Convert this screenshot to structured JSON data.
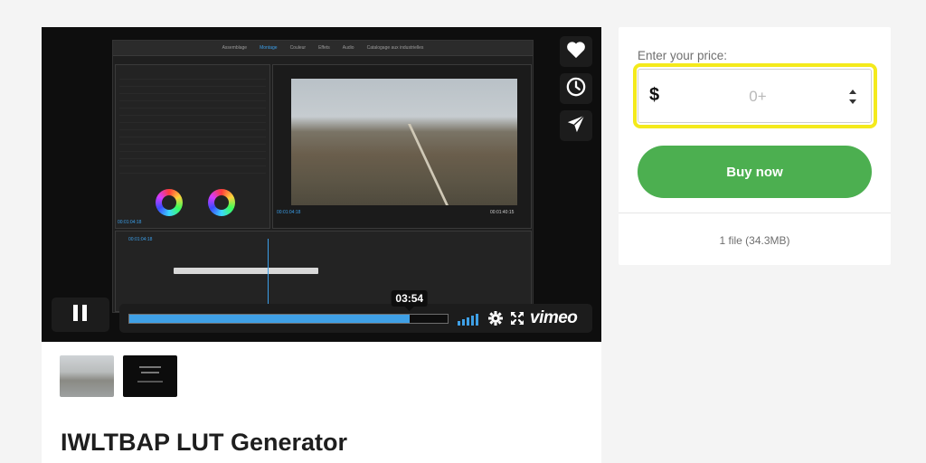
{
  "player": {
    "editor_tabs": [
      "Assemblage",
      "Montage",
      "Couleur",
      "Effets",
      "Audio",
      "Catalogage aux industrielles"
    ],
    "active_tab": "Montage",
    "source_timecode": "00:01:04:18",
    "program_timecode": "00:01:04:18",
    "program_duration": "00:01:40:15",
    "progress": 0.88,
    "time_tooltip": "03:54",
    "brand": "vimeo",
    "side_actions": [
      {
        "name": "like",
        "icon": "heart-icon"
      },
      {
        "name": "watch-later",
        "icon": "clock-icon"
      },
      {
        "name": "share",
        "icon": "paper-plane-icon"
      }
    ]
  },
  "thumbnails": [
    {
      "name": "aerial-view"
    },
    {
      "name": "dark-title"
    }
  ],
  "product": {
    "title": "IWLTBAP LUT Generator"
  },
  "purchase": {
    "price_label": "Enter your price:",
    "currency": "$",
    "price_placeholder": "0+",
    "price_value": "",
    "buy_label": "Buy now",
    "file_info": "1 file (34.3MB)",
    "accent_color": "#4caf50",
    "highlight_color": "#f4ea1c"
  }
}
